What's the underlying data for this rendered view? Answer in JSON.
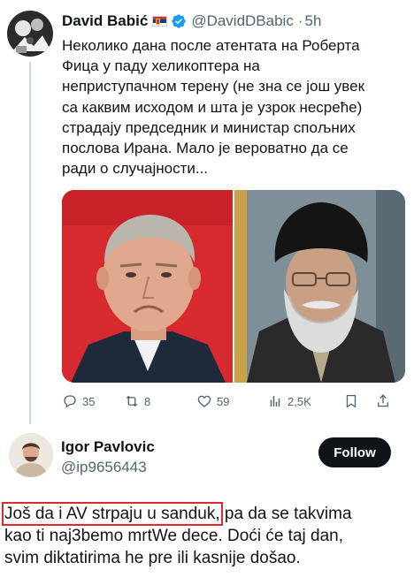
{
  "tweet": {
    "author_name": "David Babić",
    "handle": "@DavidDBabic",
    "time": "5h",
    "lines": [
      "Неколико дана после атентата на Роберта",
      "Фица у паду хеликоптера на",
      "неприступачном терену (не зна се још увек",
      "са каквим исходом и шта је узрок несреће)",
      "страдају председник и министар спољних",
      "послова Ирана. Мало је вероватно да се",
      "ради о случајности..."
    ],
    "metrics": {
      "replies": "35",
      "retweets": "8",
      "likes": "59",
      "views": "2,5K"
    }
  },
  "reply": {
    "author_name": "Igor Pavlovic",
    "handle": "@ip9656443",
    "follow_label": "Follow",
    "highlighted": "Još da i AV strpaju u sanduk,",
    "line1_rest": " pa da se takvima",
    "line2": "kao ti naj3bemo mrtWe dece. Doći će taj dan,",
    "line3": "svim diktatirima he pre ili kasnije došao."
  },
  "colors": {
    "verified": "#1d9bf0",
    "highlight_box": "#e0282e",
    "text_secondary": "#536471"
  },
  "icons": [
    "verified-badge-icon",
    "serbian-flag-icon",
    "reply-icon",
    "retweet-icon",
    "like-icon",
    "views-icon",
    "bookmark-icon",
    "share-icon"
  ]
}
